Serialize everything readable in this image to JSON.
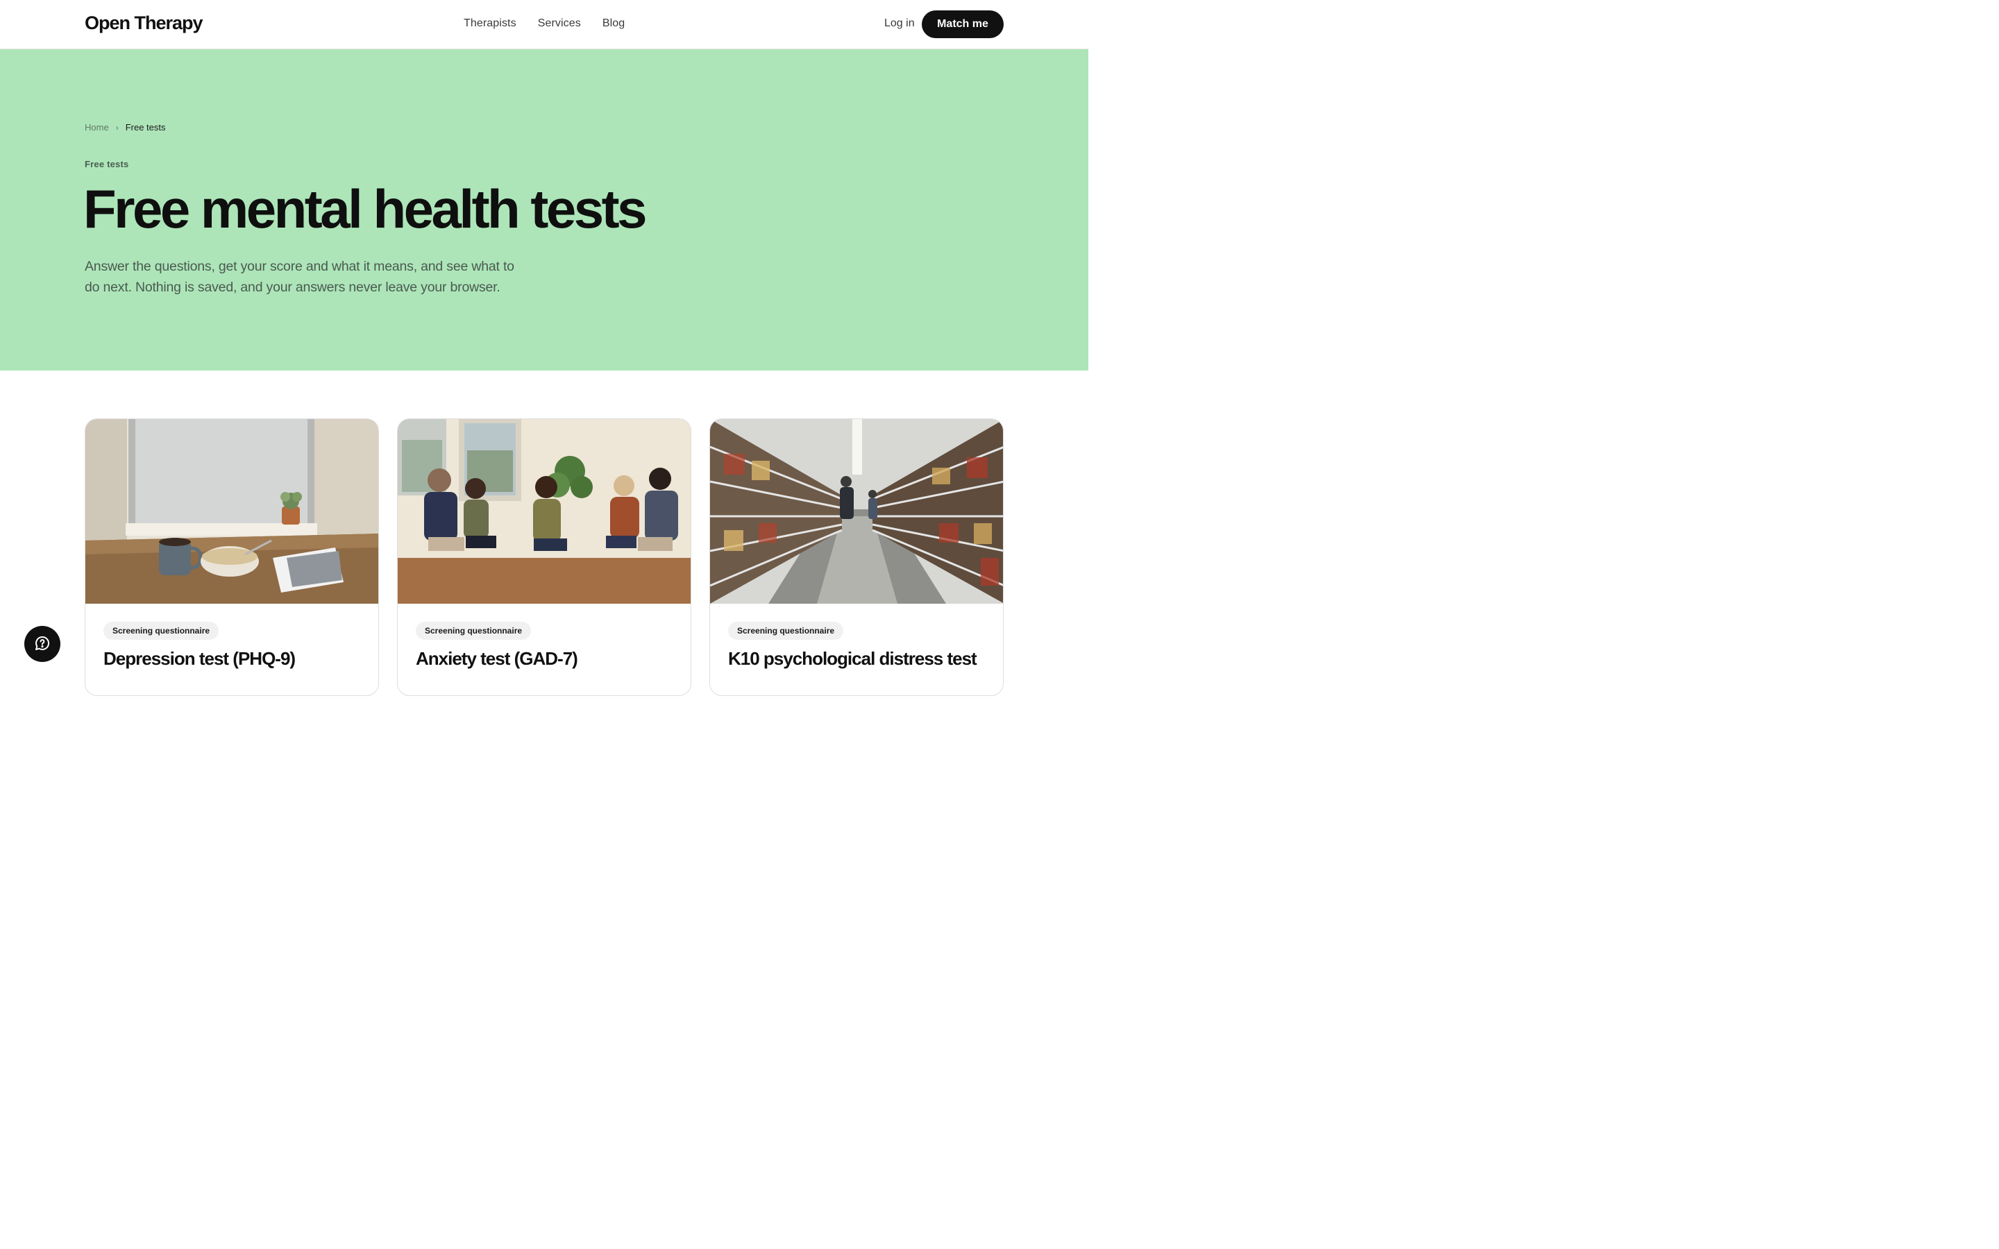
{
  "header": {
    "logo": "Open Therapy",
    "nav": [
      "Therapists",
      "Services",
      "Blog"
    ],
    "login_label": "Log in",
    "cta_label": "Match me"
  },
  "hero": {
    "background": "#ade5b9",
    "breadcrumb": {
      "home": "Home",
      "separator": "›",
      "current": "Free tests"
    },
    "eyebrow": "Free tests",
    "title": "Free mental health tests",
    "subtitle": "Answer the questions, get your score and what it means, and see what to do next. Nothing is saved, and your answers never leave your browser."
  },
  "cards": [
    {
      "badge": "Screening questionnaire",
      "title": "Depression test (PHQ-9)",
      "image": "photo-windowsill-breakfast"
    },
    {
      "badge": "Screening questionnaire",
      "title": "Anxiety test (GAD-7)",
      "image": "photo-group-conversation"
    },
    {
      "badge": "Screening questionnaire",
      "title": "K10 psychological distress test",
      "image": "photo-supermarket-aisle"
    }
  ],
  "help_button": {
    "icon": "help-chat-icon"
  }
}
